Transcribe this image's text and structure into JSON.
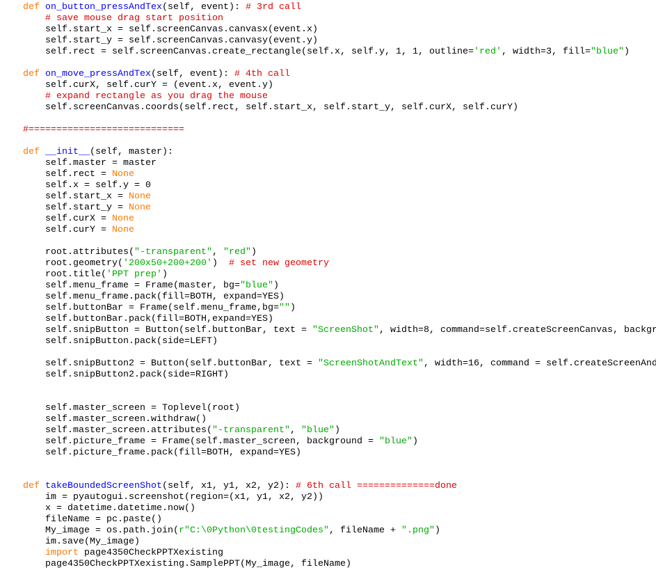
{
  "editor": {
    "colors": {
      "keyword": "#ff7700",
      "function_name": "#0000ff",
      "comment": "#dd0000",
      "string": "#00aa00",
      "text": "#000000",
      "background": "#ffffff"
    },
    "lines": [
      [
        {
          "t": "kw",
          "v": "def"
        },
        {
          "t": "tx",
          "v": " "
        },
        {
          "t": "fn",
          "v": "on_button_pressAndTex"
        },
        {
          "t": "tx",
          "v": "(self, event): "
        },
        {
          "t": "cm",
          "v": "# 3rd call"
        }
      ],
      [
        {
          "t": "tx",
          "v": "    "
        },
        {
          "t": "cm",
          "v": "# save mouse drag start position"
        }
      ],
      [
        {
          "t": "tx",
          "v": "    self.start_x = self.screenCanvas.canvasx(event.x)"
        }
      ],
      [
        {
          "t": "tx",
          "v": "    self.start_y = self.screenCanvas.canvasy(event.y)"
        }
      ],
      [
        {
          "t": "tx",
          "v": "    self.rect = self.screenCanvas.create_rectangle(self.x, self.y, 1, 1, outline="
        },
        {
          "t": "st",
          "v": "'red'"
        },
        {
          "t": "tx",
          "v": ", width=3, fill="
        },
        {
          "t": "st",
          "v": "\"blue\""
        },
        {
          "t": "tx",
          "v": ")"
        }
      ],
      [],
      [
        {
          "t": "kw",
          "v": "def"
        },
        {
          "t": "tx",
          "v": " "
        },
        {
          "t": "fn",
          "v": "on_move_pressAndTex"
        },
        {
          "t": "tx",
          "v": "(self, event): "
        },
        {
          "t": "cm",
          "v": "# 4th call"
        }
      ],
      [
        {
          "t": "tx",
          "v": "    self.curX, self.curY = (event.x, event.y)"
        }
      ],
      [
        {
          "t": "tx",
          "v": "    "
        },
        {
          "t": "cm",
          "v": "# expand rectangle as you drag the mouse"
        }
      ],
      [
        {
          "t": "tx",
          "v": "    self.screenCanvas.coords(self.rect, self.start_x, self.start_y, self.curX, self.curY)"
        }
      ],
      [],
      [
        {
          "t": "cm",
          "v": "#============================"
        }
      ],
      [],
      [
        {
          "t": "kw",
          "v": "def"
        },
        {
          "t": "tx",
          "v": " "
        },
        {
          "t": "fn",
          "v": "__init__"
        },
        {
          "t": "tx",
          "v": "(self, master):"
        }
      ],
      [
        {
          "t": "tx",
          "v": "    self.master = master"
        }
      ],
      [
        {
          "t": "tx",
          "v": "    self.rect = "
        },
        {
          "t": "kw",
          "v": "None"
        }
      ],
      [
        {
          "t": "tx",
          "v": "    self.x = self.y = 0"
        }
      ],
      [
        {
          "t": "tx",
          "v": "    self.start_x = "
        },
        {
          "t": "kw",
          "v": "None"
        }
      ],
      [
        {
          "t": "tx",
          "v": "    self.start_y = "
        },
        {
          "t": "kw",
          "v": "None"
        }
      ],
      [
        {
          "t": "tx",
          "v": "    self.curX = "
        },
        {
          "t": "kw",
          "v": "None"
        }
      ],
      [
        {
          "t": "tx",
          "v": "    self.curY = "
        },
        {
          "t": "kw",
          "v": "None"
        }
      ],
      [],
      [
        {
          "t": "tx",
          "v": "    root.attributes("
        },
        {
          "t": "st",
          "v": "\"-transparent\""
        },
        {
          "t": "tx",
          "v": ", "
        },
        {
          "t": "st",
          "v": "\"red\""
        },
        {
          "t": "tx",
          "v": ")"
        }
      ],
      [
        {
          "t": "tx",
          "v": "    root.geometry("
        },
        {
          "t": "st",
          "v": "'200x50+200+200'"
        },
        {
          "t": "tx",
          "v": ")  "
        },
        {
          "t": "cm",
          "v": "# set new geometry"
        }
      ],
      [
        {
          "t": "tx",
          "v": "    root.title("
        },
        {
          "t": "st",
          "v": "'PPT prep'"
        },
        {
          "t": "tx",
          "v": ")"
        }
      ],
      [
        {
          "t": "tx",
          "v": "    self.menu_frame = Frame(master, bg="
        },
        {
          "t": "st",
          "v": "\"blue\""
        },
        {
          "t": "tx",
          "v": ")"
        }
      ],
      [
        {
          "t": "tx",
          "v": "    self.menu_frame.pack(fill=BOTH, expand=YES)"
        }
      ],
      [
        {
          "t": "tx",
          "v": "    self.buttonBar = Frame(self.menu_frame,bg="
        },
        {
          "t": "st",
          "v": "\"\""
        },
        {
          "t": "tx",
          "v": ")"
        }
      ],
      [
        {
          "t": "tx",
          "v": "    self.buttonBar.pack(fill=BOTH,expand=YES)"
        }
      ],
      [
        {
          "t": "tx",
          "v": "    self.snipButton = Button(self.buttonBar, text = "
        },
        {
          "t": "st",
          "v": "\"ScreenShot\""
        },
        {
          "t": "tx",
          "v": ", width=8, command=self.createScreenCanvas, backgr"
        }
      ],
      [
        {
          "t": "tx",
          "v": "    self.snipButton.pack(side=LEFT)"
        }
      ],
      [],
      [
        {
          "t": "tx",
          "v": "    self.snipButton2 = Button(self.buttonBar, text = "
        },
        {
          "t": "st",
          "v": "\"ScreenShotAndText\""
        },
        {
          "t": "tx",
          "v": ", width=16, command = self.createScreenAnd"
        }
      ],
      [
        {
          "t": "tx",
          "v": "    self.snipButton2.pack(side=RIGHT)"
        }
      ],
      [],
      [],
      [
        {
          "t": "tx",
          "v": "    self.master_screen = Toplevel(root)"
        }
      ],
      [
        {
          "t": "tx",
          "v": "    self.master_screen.withdraw()"
        }
      ],
      [
        {
          "t": "tx",
          "v": "    self.master_screen.attributes("
        },
        {
          "t": "st",
          "v": "\"-transparent\""
        },
        {
          "t": "tx",
          "v": ", "
        },
        {
          "t": "st",
          "v": "\"blue\""
        },
        {
          "t": "tx",
          "v": ")"
        }
      ],
      [
        {
          "t": "tx",
          "v": "    self.picture_frame = Frame(self.master_screen, background = "
        },
        {
          "t": "st",
          "v": "\"blue\""
        },
        {
          "t": "tx",
          "v": ")"
        }
      ],
      [
        {
          "t": "tx",
          "v": "    self.picture_frame.pack(fill=BOTH, expand=YES)"
        }
      ],
      [],
      [],
      [
        {
          "t": "kw",
          "v": "def"
        },
        {
          "t": "tx",
          "v": " "
        },
        {
          "t": "fn",
          "v": "takeBoundedScreenShot"
        },
        {
          "t": "tx",
          "v": "(self, x1, y1, x2, y2): "
        },
        {
          "t": "cm",
          "v": "# 6th call ==============done"
        }
      ],
      [
        {
          "t": "tx",
          "v": "    im = pyautogui.screenshot(region=(x1, y1, x2, y2))"
        }
      ],
      [
        {
          "t": "tx",
          "v": "    x = datetime.datetime.now()"
        }
      ],
      [
        {
          "t": "tx",
          "v": "    fileName = pc.paste()"
        }
      ],
      [
        {
          "t": "tx",
          "v": "    My_image = os.path.join("
        },
        {
          "t": "st",
          "v": "r\"C:\\0Python\\0testingCodes\""
        },
        {
          "t": "tx",
          "v": ", fileName + "
        },
        {
          "t": "st",
          "v": "\".png\""
        },
        {
          "t": "tx",
          "v": ")"
        }
      ],
      [
        {
          "t": "tx",
          "v": "    im.save(My_image)"
        }
      ],
      [
        {
          "t": "tx",
          "v": "    "
        },
        {
          "t": "kw",
          "v": "import"
        },
        {
          "t": "tx",
          "v": " page4350CheckPPTXexisting"
        }
      ],
      [
        {
          "t": "tx",
          "v": "    page4350CheckPPTXexisting.SamplePPT(My_image, fileName)"
        }
      ]
    ]
  }
}
